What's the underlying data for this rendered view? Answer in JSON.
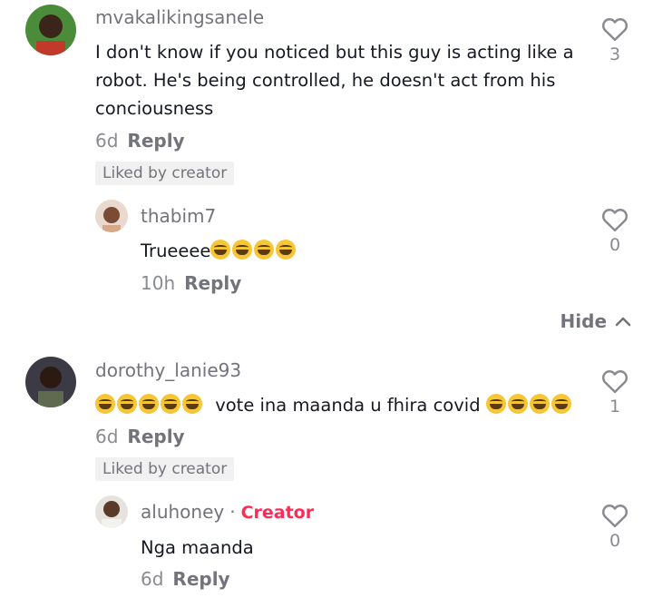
{
  "comments": [
    {
      "username": "mvakalikingsanele",
      "lines": [
        "I don't know if you noticed but this guy is acting like a",
        "robot. He's being controlled, he doesn't act from his",
        "conciousness"
      ],
      "age": "6d",
      "reply_label": "Reply",
      "badge": "Liked by creator",
      "likes": "3",
      "avatar_color": "#3a6b2e",
      "reply": {
        "username": "thabim7",
        "text": "Trueeee",
        "emoji_count": 4,
        "age": "10h",
        "reply_label": "Reply",
        "likes": "0",
        "avatar_color": "#c79a7d"
      }
    },
    {
      "username": "dorothy_lanie93",
      "text_prefix_emojis": 5,
      "text": "vote ina maanda u fhira covid",
      "text_suffix_emojis": 4,
      "age": "6d",
      "reply_label": "Reply",
      "badge": "Liked by creator",
      "likes": "1",
      "avatar_color": "#2d2a33",
      "reply": {
        "username": "aluhoney",
        "creator_separator": "·",
        "creator_label": "Creator",
        "text": "Nga maanda",
        "age": "6d",
        "reply_label": "Reply",
        "likes": "0",
        "avatar_color": "#d8d4d0"
      }
    }
  ],
  "hide_label": "Hide",
  "icons": {
    "like": "heart-outline-icon",
    "hide": "chevron-up-icon",
    "emoji": "laughing-emoji-icon"
  },
  "colors": {
    "creator_accent": "#fe2c55",
    "text": "#161823",
    "muted": "#73747b"
  }
}
